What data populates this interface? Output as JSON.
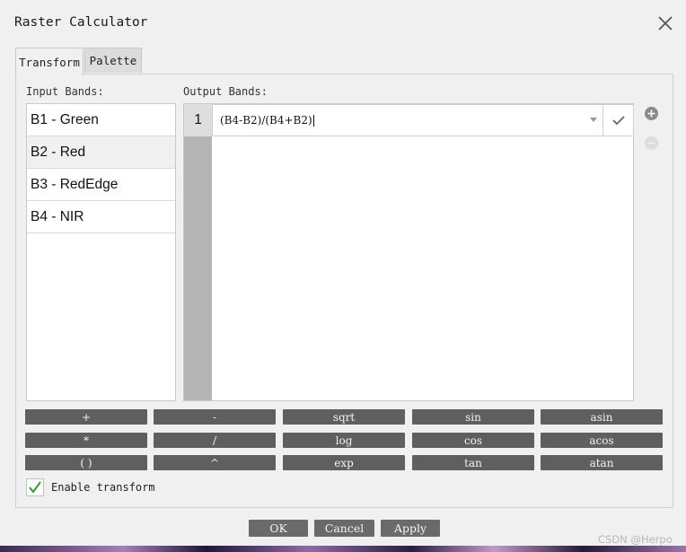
{
  "window": {
    "title": "Raster Calculator"
  },
  "tabs": [
    {
      "label": "Transform"
    },
    {
      "label": "Palette"
    }
  ],
  "input_bands": {
    "label": "Input Bands:",
    "items": [
      {
        "label": "B1 - Green"
      },
      {
        "label": "B2 - Red"
      },
      {
        "label": "B3 - RedEdge"
      },
      {
        "label": "B4 - NIR"
      }
    ]
  },
  "output_bands": {
    "label": "Output Bands:",
    "rows": [
      {
        "index": "1",
        "expression": "(B4-B2)/(B4+B2)"
      }
    ]
  },
  "operators": [
    [
      "+",
      "-",
      "sqrt",
      "sin",
      "asin"
    ],
    [
      "*",
      "/",
      "log",
      "cos",
      "acos"
    ],
    [
      "( )",
      "^",
      "exp",
      "tan",
      "atan"
    ]
  ],
  "enable_transform": {
    "label": "Enable transform",
    "checked": true
  },
  "buttons": {
    "ok": "OK",
    "cancel": "Cancel",
    "apply": "Apply"
  },
  "watermark": "CSDN @Herpo",
  "colors": {
    "button_bg": "#5f5f5f",
    "check_green": "#2e9e2e"
  },
  "icons": {
    "close": "close-icon",
    "confirm": "check-icon",
    "add": "plus-circle-icon",
    "remove": "minus-circle-icon"
  }
}
